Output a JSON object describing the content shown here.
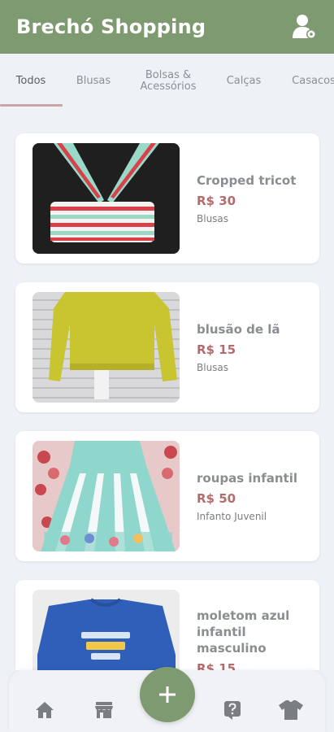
{
  "app_bar": {
    "title": "Brechó Shopping"
  },
  "tabs": [
    {
      "label": "Todos"
    },
    {
      "label": "Blusas"
    },
    {
      "label": "Bolsas &\nAcessórios"
    },
    {
      "label": "Calças"
    },
    {
      "label": "Casacos"
    }
  ],
  "products": [
    {
      "name": "Cropped tricot",
      "price": "R$ 30",
      "category": "Blusas"
    },
    {
      "name": "blusão de lã",
      "price": "R$ 15",
      "category": "Blusas"
    },
    {
      "name": "roupas infantil",
      "price": "R$ 50",
      "category": "Infanto Juvenil"
    },
    {
      "name": "moletom azul infantil masculino",
      "price": "R$ 15",
      "category": ""
    }
  ],
  "bottom_nav": {
    "items": [
      "home-icon",
      "store-icon",
      "add-icon",
      "help-icon",
      "shirt-icon"
    ]
  },
  "colors": {
    "primary": "#7d9a70",
    "price": "#b56b6b",
    "background": "#eef1f6"
  }
}
